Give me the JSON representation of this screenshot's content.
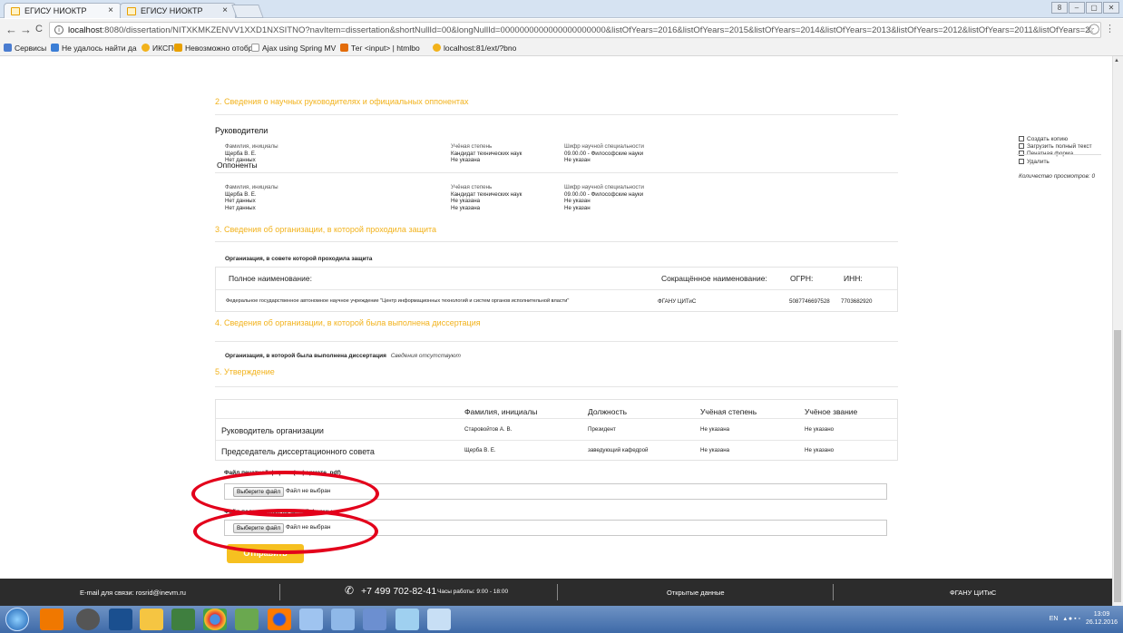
{
  "browser": {
    "tabs": [
      {
        "title": "ЕГИСУ НИОКТР",
        "close": "×"
      },
      {
        "title": "ЕГИСУ НИОКТР",
        "close": "×"
      }
    ],
    "nav": {
      "back": "←",
      "forward": "→",
      "reload": "C",
      "star": "☆",
      "info": "i"
    },
    "url_host": "localhost",
    "url_rest": ":8080/dissertation/NITXKMKZENVV1XXD1NXSITNO?navItem=dissertation&shortNullId=00&longNullId=0000000000000000000000&listOfYears=2016&listOfYears=2015&listOfYears=2014&listOfYears=2013&listOfYears=2012&listOfYears=2011&listOfYears=2",
    "window_controls": [
      "8",
      "–",
      "▢",
      "✕"
    ],
    "bookmarks": [
      {
        "label": "Сервисы",
        "color": "#4a7cd0"
      },
      {
        "label": "Не удалось найти да",
        "color": "#3b7ed6"
      },
      {
        "label": "ИКСПО",
        "color": "#f2b21b"
      },
      {
        "label": "Невозможно отобра",
        "color": "#e8a000"
      },
      {
        "label": "Ajax using Spring MV",
        "color": "#999999"
      },
      {
        "label": "Тег <input> | htmlbo",
        "color": "#e36c0a"
      },
      {
        "label": "localhost:81/ext/?bno",
        "color": "#f2b21b"
      }
    ]
  },
  "section2": {
    "title": "2. Сведения о научных руководителях и официальных оппонентах",
    "supervisors_title": "Руководители",
    "supervisors": {
      "head": [
        "Фамилия, инициалы",
        "Учёная степень",
        "Шифр научной специальности"
      ],
      "rows": [
        [
          "Щерба В. Е.",
          "Кандидат технических наук",
          "09.00.00 - Философские науки"
        ],
        [
          "Нет данных",
          "Не указана",
          "Не указан"
        ]
      ]
    },
    "opponents_title": "Оппоненты",
    "opponents": {
      "head": [
        "Фамилия, инициалы",
        "Учёная степень",
        "Шифр научной специальности"
      ],
      "rows": [
        [
          "Щерба В. Е.",
          "Кандидат технических наук",
          "09.00.00 - Философские науки"
        ],
        [
          "Нет данных",
          "Не указана",
          "Не указан"
        ],
        [
          "Нет данных",
          "Не указана",
          "Не указан"
        ]
      ]
    }
  },
  "section3": {
    "title": "3. Сведения об организации, в которой проходила защита",
    "org_label": "Организация, в совете которой проходила защита",
    "head": [
      "Полное наименование:",
      "Сокращённое наименование:",
      "ОГРН:",
      "ИНН:"
    ],
    "row": [
      "Федеральное государственное автономное научное учреждение \"Центр информационных технологий и систем органов исполнительной власти\"",
      "ФГАНУ ЦИТиС",
      "5087746697528",
      "7703682920"
    ]
  },
  "section4": {
    "title": "4. Сведения об организации, в которой была выполнена диссертация",
    "label": "Организация, в которой была выполнена диссертация",
    "value": "Сведения отсутствуют"
  },
  "section5": {
    "title": "5. Утверждение",
    "head": [
      "Фамилия, инициалы",
      "Должность",
      "Учёная степень",
      "Учёное звание"
    ],
    "rows": [
      {
        "role": "Руководитель организации",
        "name": "Старовойтов А. В.",
        "position": "Президент",
        "degree": "Не указана",
        "title": "Не указано"
      },
      {
        "role": "Председатель диссертационного совета",
        "name": "Щерба В. Е.",
        "position": "заведующий кафедрой",
        "degree": "Не указана",
        "title": "Не указано"
      }
    ]
  },
  "uploads": [
    {
      "label": "Файл печатной формы (в формате .pdf)",
      "button": "Выберите файл",
      "status": "Файл не выбран"
    },
    {
      "label": "Файл подписанной печатной формы",
      "button": "Выберите файл",
      "status": "Файл не выбран"
    }
  ],
  "submit_label": "Отправить",
  "actions": {
    "copy": "Создать копию",
    "upload": "Загрузить полный текст",
    "print": "Печатная форма",
    "delete": "Удалить",
    "views": "Количество просмотров: 0"
  },
  "footer": {
    "email": "E-mail для связи: rosrid@inevm.ru",
    "phone": "+7 499 702-82-41",
    "hours": "Часы работы: 9:00 - 18:00",
    "open_data": "Открытые данные",
    "org": "ФГАНУ ЦИТиС"
  },
  "taskbar": {
    "lang": "EN",
    "time": "13:09",
    "date": "26.12.2016",
    "icons": [
      "start-orb",
      "media-player",
      "ru-app",
      "virtualbox",
      "file-manager",
      "notes",
      "chrome",
      "editor",
      "firefox",
      "app-blue",
      "app-paint",
      "app-screen",
      "app-edit",
      "app-draw"
    ]
  },
  "colors": {
    "accent": "#f2b21b",
    "footer_bg": "#2c2c2c",
    "annotation": "#e3001b"
  }
}
